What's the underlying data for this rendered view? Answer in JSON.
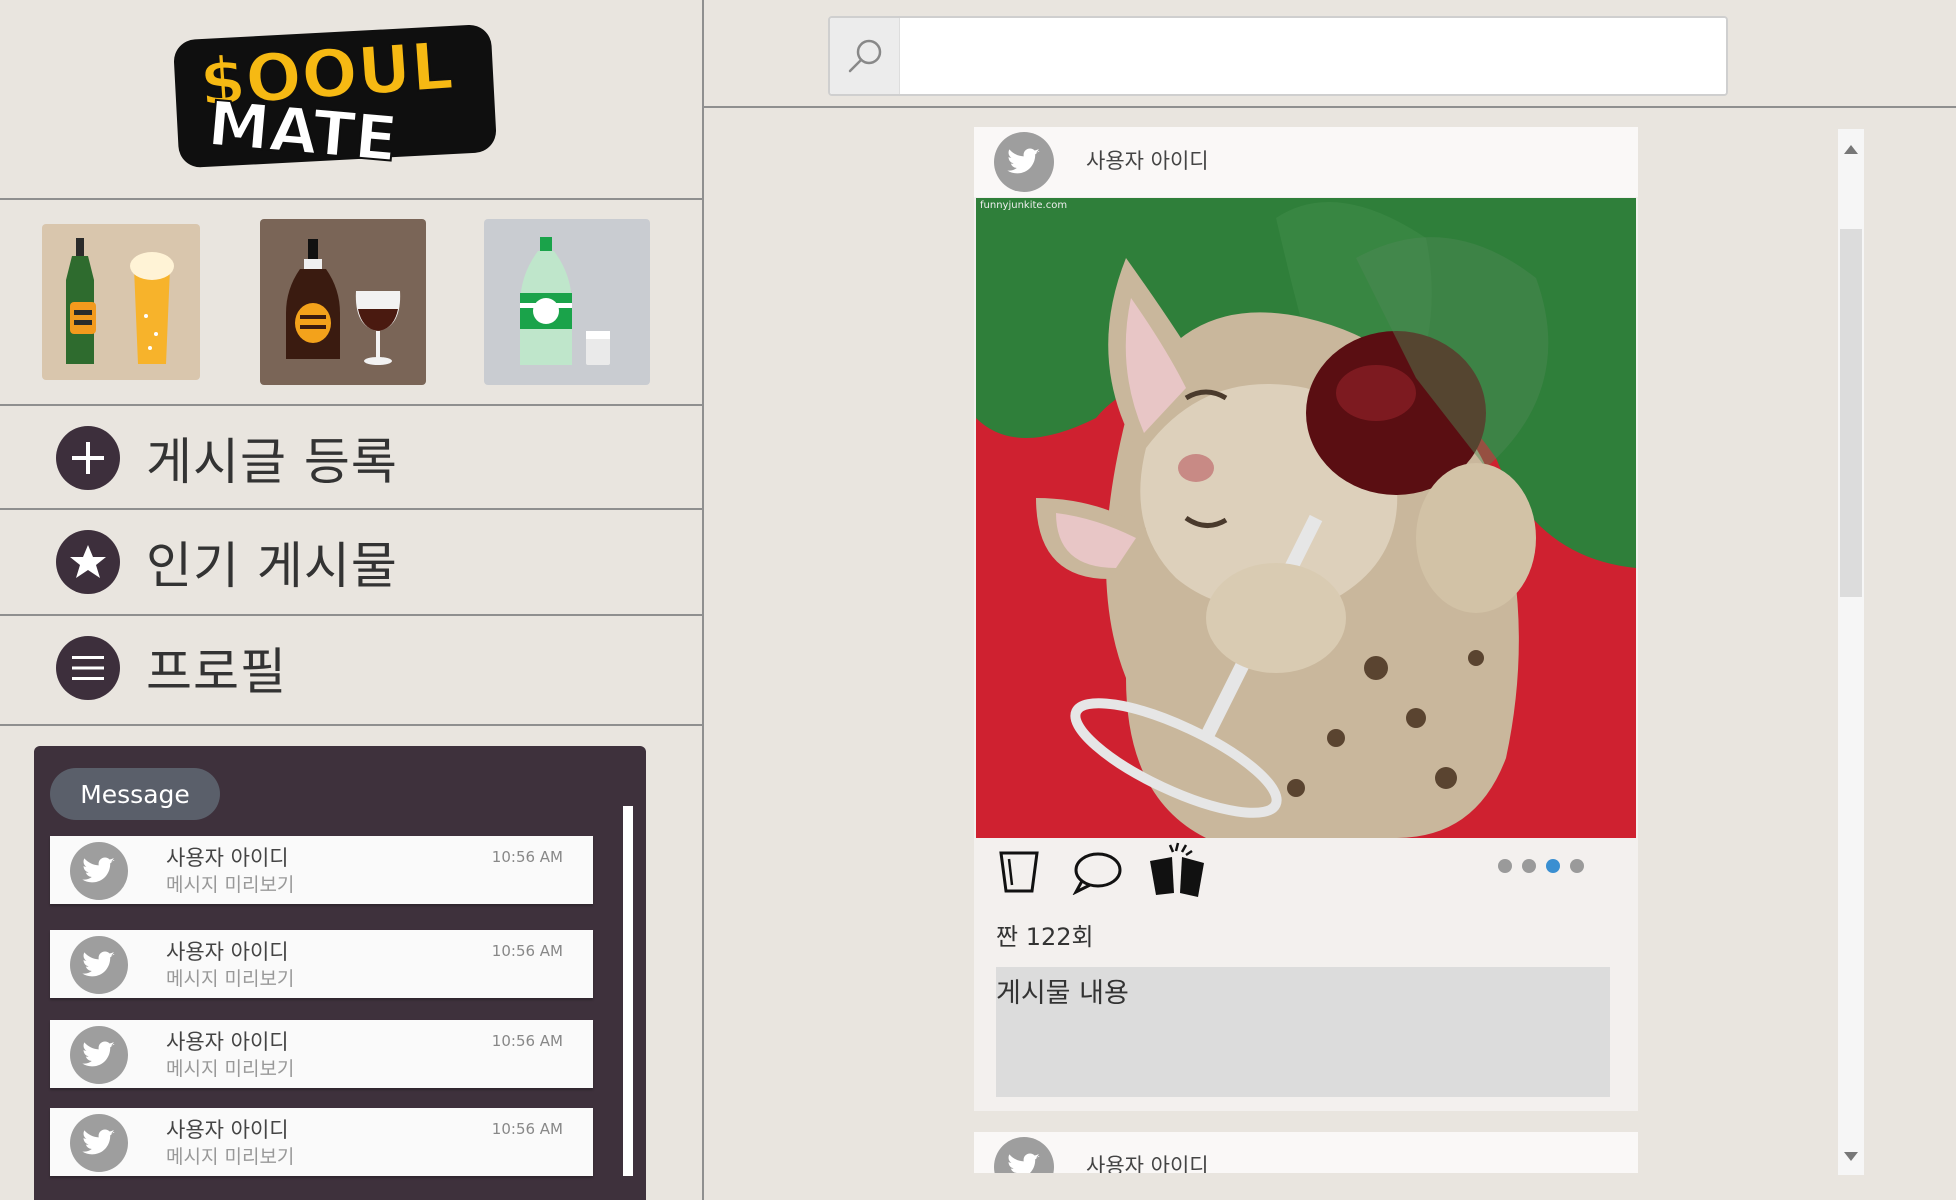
{
  "app": {
    "logo_line1": "$OOUL",
    "logo_line2": "MATE"
  },
  "categories": [
    {
      "name": "beer",
      "icon": "beer-icon"
    },
    {
      "name": "whiskey",
      "icon": "whiskey-icon"
    },
    {
      "name": "soju",
      "icon": "soju-icon"
    }
  ],
  "nav": {
    "new_post": "게시글 등록",
    "popular": "인기 게시물",
    "profile": "프로필"
  },
  "messages": {
    "tab_label": "Message",
    "items": [
      {
        "user": "사용자 아이디",
        "preview": "메시지 미리보기",
        "time": "10:56 AM"
      },
      {
        "user": "사용자 아이디",
        "preview": "메시지 미리보기",
        "time": "10:56 AM"
      },
      {
        "user": "사용자 아이디",
        "preview": "메시지 미리보기",
        "time": "10:56 AM"
      },
      {
        "user": "사용자 아이디",
        "preview": "메시지 미리보기",
        "time": "10:56 AM"
      }
    ]
  },
  "search": {
    "placeholder": "",
    "value": ""
  },
  "feed": {
    "posts": [
      {
        "user": "사용자 아이디",
        "image_watermark": "funnyjunkite.com",
        "cheers_text": "짠 122회",
        "content": "게시물 내용",
        "carousel_total": 4,
        "carousel_active": 3
      },
      {
        "user": "사용자 아이디"
      }
    ]
  },
  "colors": {
    "background": "#e9e5df",
    "panel_dark": "#3e313c",
    "accent_dot": "#3a8fd1",
    "avatar_gray": "#9e9e9e"
  }
}
